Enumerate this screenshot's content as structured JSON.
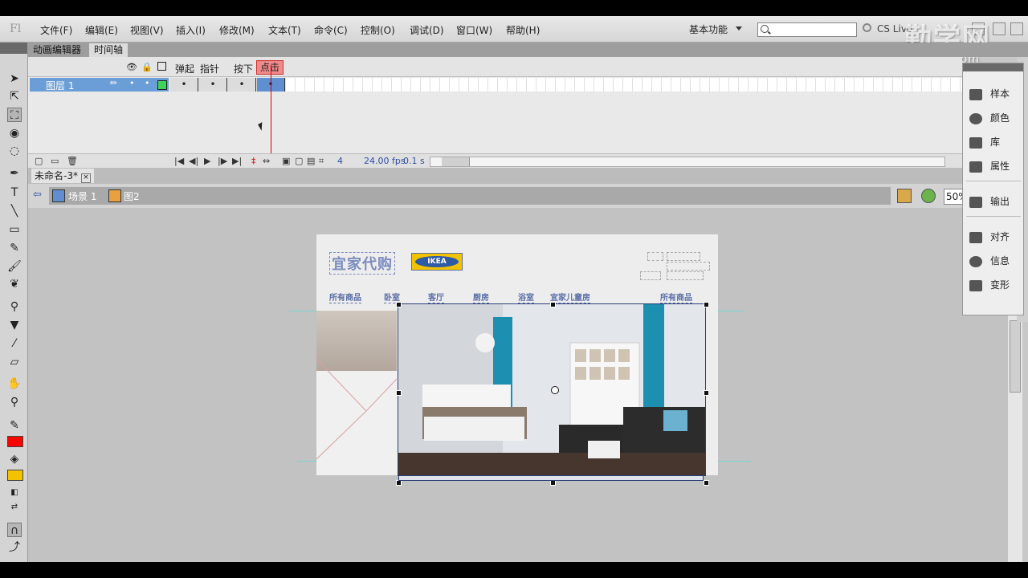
{
  "app": {
    "logo": "Fl",
    "workspace": "基本功能",
    "cs_live": "CS Live",
    "watermark": "勤学网",
    "watermark_sub": "qinxue.com"
  },
  "menu": [
    "文件(F)",
    "编辑(E)",
    "视图(V)",
    "插入(I)",
    "修改(M)",
    "文本(T)",
    "命令(C)",
    "控制(O)",
    "调试(D)",
    "窗口(W)",
    "帮助(H)"
  ],
  "panel_tabs": [
    "动画编辑器",
    "时间轴"
  ],
  "timeline": {
    "states": [
      "弹起",
      "指针",
      "按下",
      "点击"
    ],
    "layer_name": "图层 1",
    "current_frame": "4",
    "fps": "24.00 fps",
    "time": "0.1 s"
  },
  "document": {
    "tab": "未命名-3*",
    "close": "×",
    "crumbs": [
      "场景 1",
      "图2"
    ],
    "zoom": "50%"
  },
  "canvas": {
    "logo_text": "宜家代购",
    "ikea": "IKEA",
    "nav": [
      "所有商品",
      "卧室",
      "客厅",
      "厨房",
      "浴室",
      "宜家儿童房",
      "所有商品"
    ]
  },
  "right_panel": [
    "样本",
    "颜色",
    "库",
    "属性",
    "输出",
    "对齐",
    "信息",
    "变形"
  ],
  "colors": {
    "stroke": "#ff0000",
    "fill": "#f2c300",
    "selection": "#2a3f7a"
  }
}
